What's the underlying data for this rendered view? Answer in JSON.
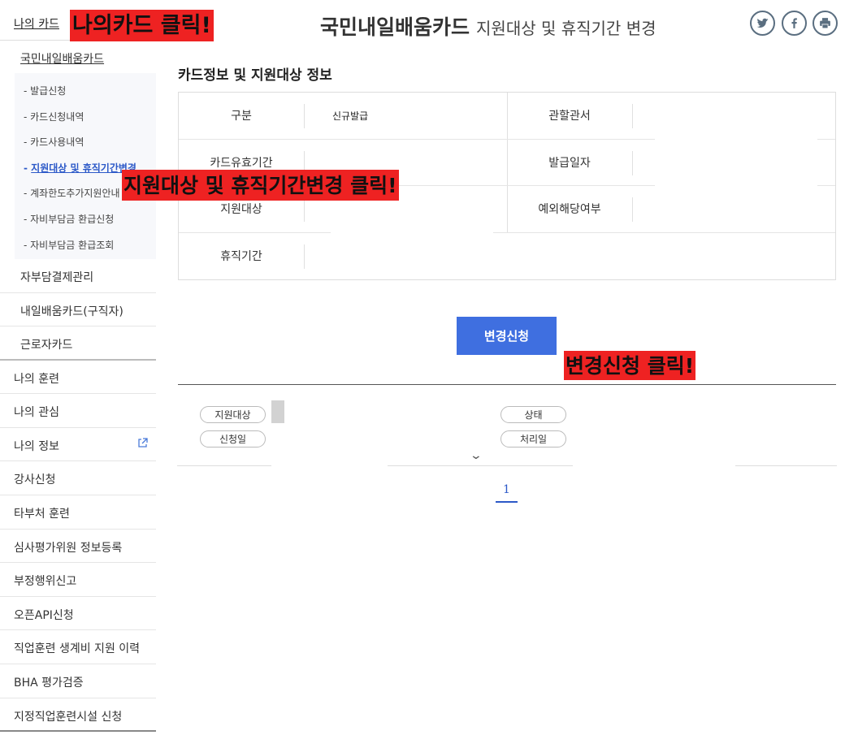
{
  "sidebar": {
    "top": "나의 카드",
    "sub_title": "국민내일배움카드",
    "sub_items": [
      "- 발급신청",
      "- 카드신청내역",
      "- 카드사용내역",
      "지원대상 및 휴직기간변경",
      "- 계좌한도추가지원안내",
      "- 자비부담금 환급신청",
      "- 자비부담금 환급조회"
    ],
    "active_prefix": "- ",
    "level2": [
      "자부담결제관리",
      "내일배움카드(구직자)",
      "근로자카드"
    ],
    "level1": [
      "나의 훈련",
      "나의 관심",
      "나의 정보",
      "강사신청",
      "타부처 훈련",
      "심사평가위원 정보등록",
      "부정행위신고",
      "오픈API신청",
      "직업훈련 생계비 지원 이력",
      "BHA 평가검증",
      "지정직업훈련시설 신청"
    ],
    "ext_icon": "external-link-icon"
  },
  "header": {
    "title": "국민내일배움카드",
    "subtitle": "지원대상 및 휴직기간 변경",
    "social_icons": [
      "twitter-icon",
      "facebook-icon",
      "print-icon"
    ]
  },
  "section": {
    "title": "카드정보 및 지원대상 정보",
    "rows": [
      {
        "label": "구분",
        "value": "신규발급",
        "label2": "관할관서",
        "value2": ""
      },
      {
        "label": "카드유효기간",
        "value": "",
        "label2": "발급일자",
        "value2": ""
      },
      {
        "label": "지원대상",
        "value": "",
        "label2": "예외해당여부",
        "value2": ""
      },
      {
        "label": "휴직기간",
        "value": ""
      }
    ]
  },
  "change_button": "변경신청",
  "list": {
    "pills": [
      "지원대상",
      "상태",
      "신청일",
      "처리일"
    ],
    "chevron": "⌄"
  },
  "pagination": {
    "current": "1"
  },
  "annotations": {
    "a1": "나의카드 클릭!",
    "a2": "지원대상 및 휴직기간변경 클릭!",
    "a3": "변경신청 클릭!"
  },
  "colors": {
    "accent": "#3f6fe0",
    "annotation": "#ee2222",
    "link": "#2c59c8"
  }
}
